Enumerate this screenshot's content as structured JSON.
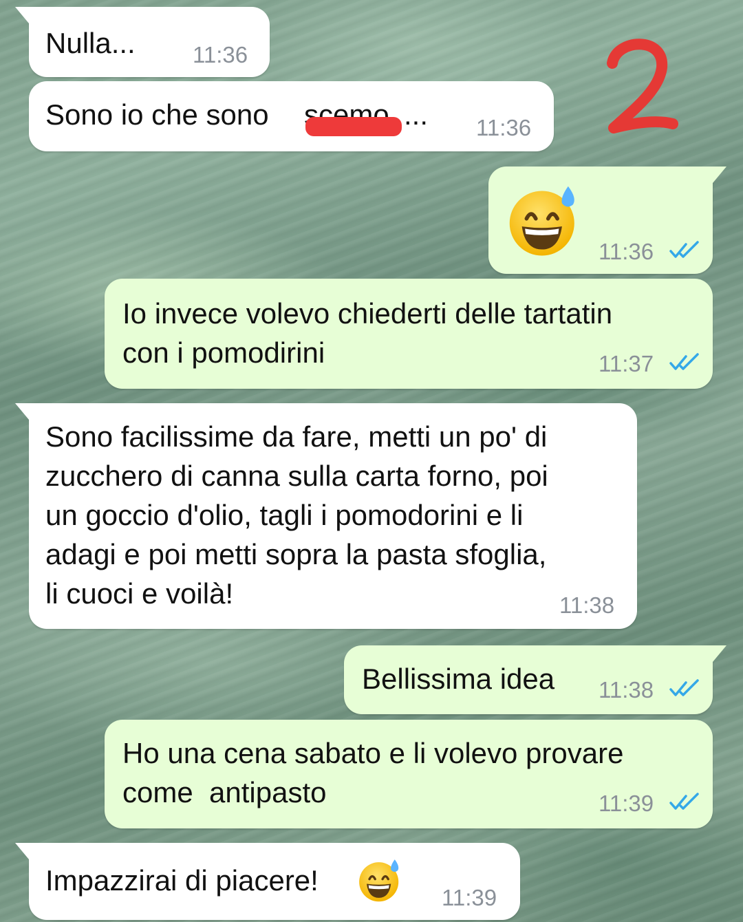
{
  "annotation": {
    "number": "2",
    "color": "#e53935"
  },
  "colors": {
    "incoming_bubble": "#ffffff",
    "outgoing_bubble": "#e7fed6",
    "read_ticks": "#34a8e8",
    "redaction": "#ee3a3a"
  },
  "messages": [
    {
      "direction": "incoming",
      "text": "Nulla...",
      "time": "11:36"
    },
    {
      "direction": "incoming",
      "text_before": "Sono io che sono ",
      "text_redacted": "scemo",
      "text_after": "...",
      "time": "11:36",
      "redacted": true
    },
    {
      "direction": "outgoing",
      "emoji": "grinning-face-with-sweat",
      "time": "11:36",
      "status": "read"
    },
    {
      "direction": "outgoing",
      "lines": [
        "Io invece volevo chiederti delle tartatin",
        "con i pomodirini"
      ],
      "time": "11:37",
      "status": "read"
    },
    {
      "direction": "incoming",
      "lines": [
        "Sono facilissime da fare, metti un po' di",
        "zucchero di canna sulla carta forno, poi",
        "un goccio d'olio, tagli i pomodorini e li",
        "adagi e poi metti sopra la pasta sfoglia,",
        "li cuoci e voilà!"
      ],
      "time": "11:38"
    },
    {
      "direction": "outgoing",
      "text": "Bellissima idea",
      "time": "11:38",
      "status": "read"
    },
    {
      "direction": "outgoing",
      "lines": [
        "Ho una cena sabato e li volevo provare",
        "come  antipasto"
      ],
      "time": "11:39",
      "status": "read"
    },
    {
      "direction": "incoming",
      "text": "Impazzirai di piacere!",
      "emoji": "grinning-face-with-sweat",
      "time": "11:39"
    }
  ]
}
